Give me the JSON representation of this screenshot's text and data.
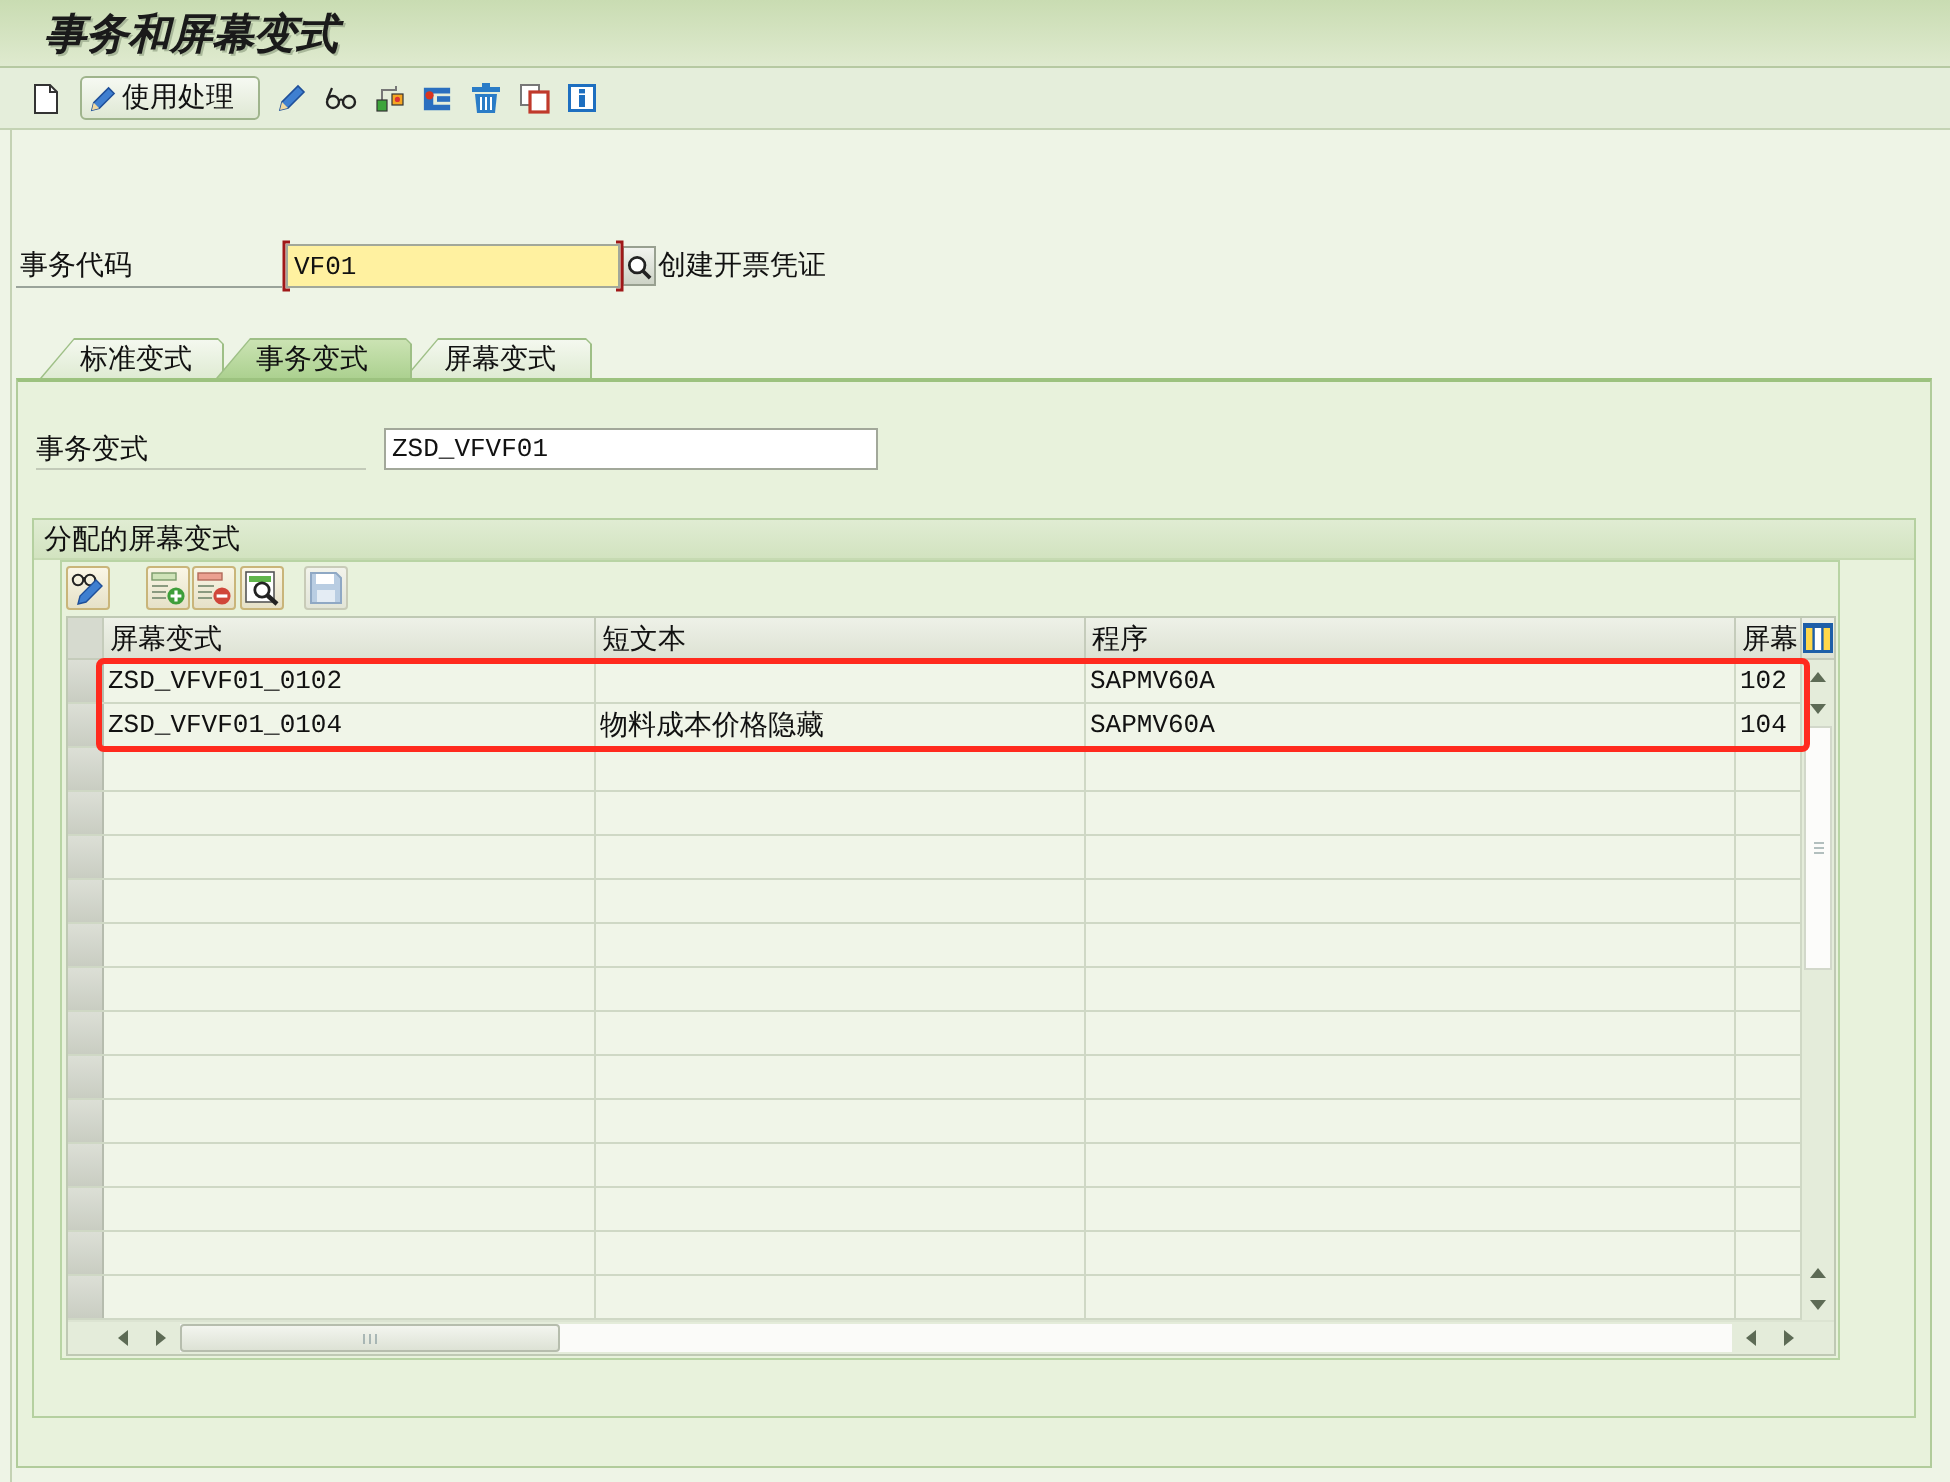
{
  "window": {
    "title": "事务和屏幕变式"
  },
  "toolbar": {
    "button": "使用处理"
  },
  "transaction_code": {
    "label": "事务代码",
    "value": "VF01",
    "focused": true,
    "description": "创建开票凭证"
  },
  "tabs": [
    {
      "label": "标准变式",
      "selected": false
    },
    {
      "label": "事务变式",
      "selected": true
    },
    {
      "label": "屏幕变式",
      "selected": false
    }
  ],
  "transaction_variant": {
    "label": "事务变式",
    "value": "ZSD_VFVF01"
  },
  "assigned_screen_variants": {
    "title": "分配的屏幕变式",
    "toolbar_buttons": [
      {
        "disabled": false
      },
      {
        "disabled": false
      },
      {
        "disabled": false
      },
      {
        "disabled": false
      },
      {
        "disabled": true
      }
    ],
    "table": {
      "columns": [
        "屏幕变式",
        "短文本",
        "程序",
        "屏幕"
      ],
      "rows": [
        {
          "screen_variant": "ZSD_VFVF01_0102",
          "program": "SAPMV60A",
          "screen": "102",
          "highlighted": true
        },
        {
          "screen_variant": "ZSD_VFVF01_0104",
          "short_text": "物料成本价格隐藏",
          "program": "SAPMV60A",
          "screen": "104",
          "highlighted": true
        }
      ]
    }
  }
}
